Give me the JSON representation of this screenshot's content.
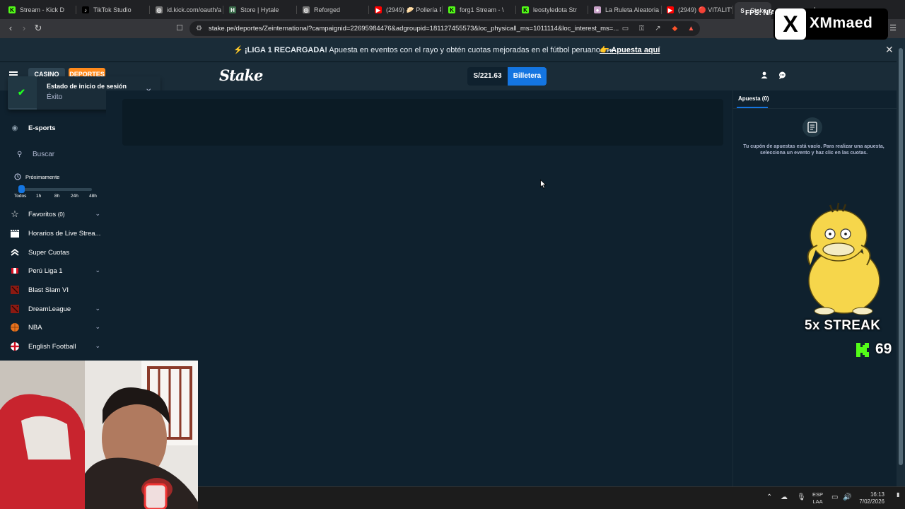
{
  "browser": {
    "tabs": [
      {
        "label": "Stream - Kick D",
        "fav": "K",
        "color": "#53fc18"
      },
      {
        "label": "TikTok Studio",
        "fav": "♪",
        "color": "#000000"
      },
      {
        "label": "id.kick.com/oauth/a",
        "fav": "◎",
        "color": "#777777"
      },
      {
        "label": "Store | Hytale",
        "fav": "H",
        "color": "#3a6b4a"
      },
      {
        "label": "Reforged",
        "fav": "◎",
        "color": "#777777"
      },
      {
        "label": "(2949) 🥟 Pollería P",
        "fav": "▶",
        "color": "#ff0000"
      },
      {
        "label": "forg1 Stream - \\",
        "fav": "K",
        "color": "#53fc18"
      },
      {
        "label": "leostyledota Str",
        "fav": "K",
        "color": "#53fc18"
      },
      {
        "label": "La Ruleta Aleatoria",
        "fav": "●",
        "color": "#c8a2c8"
      },
      {
        "label": "(2949) 🔴 VITALITY",
        "fav": "▶",
        "color": "#ff0000"
      },
      {
        "label": "Stake.pe",
        "fav": "S",
        "color": "#35363a"
      }
    ],
    "url": "stake.pe/deportes/Zeinternational?campaignid=22695984476&adgroupid=181127455573&loc_physicall_ms=1011114&loc_interest_ms=..."
  },
  "promo": {
    "headline": "¡LIGA 1 RECARGADA!",
    "body": " Apuesta en eventos con el rayo y obtén cuotas mejoradas en el fútbol peruano.",
    "flag": "PE",
    "cta": "Apuesta aquí"
  },
  "header": {
    "casino": "CASINO",
    "sports": "DEPORTES",
    "logo": "Stake",
    "balance": "S/221.63",
    "wallet": "Billetera"
  },
  "toast": {
    "title": "Estado de inicio de sesión",
    "message": "Éxito"
  },
  "sidebar": {
    "esports": "E-sports",
    "search": "Buscar",
    "soon": "Próximamente",
    "ticks": [
      "Todos",
      "1h",
      "8h",
      "24h",
      "48h"
    ],
    "items": [
      {
        "label": "Favoritos",
        "count": "(0)",
        "icon": "star-icon"
      },
      {
        "label": "Horarios de Live Strea...",
        "icon": "clapper-icon"
      },
      {
        "label": "Super Cuotas",
        "icon": "chevrons-up-icon"
      },
      {
        "label": "Perú Liga 1",
        "icon": "peru-flag-icon"
      },
      {
        "label": "Blast Slam VI",
        "icon": "dota-icon"
      },
      {
        "label": "DreamLeague",
        "icon": "dota-icon"
      },
      {
        "label": "NBA",
        "icon": "basketball-icon"
      },
      {
        "label": "English Football",
        "icon": "england-flag-icon"
      }
    ]
  },
  "betslip": {
    "tab": "Apuesta (0)",
    "empty": "Tu cupón de apuestas está vacío. Para realizar una apuesta, selecciona un evento y haz clic en las cuotas."
  },
  "overlay": {
    "fps": "FPS: N/A",
    "x_logo": "X",
    "x_name": "XMmaed",
    "streak": "5x STREAK",
    "k_count": "69"
  },
  "taskbar": {
    "lang_top": "ESP",
    "lang_bottom": "LAA",
    "time": "16:13",
    "date": "7/02/2026"
  }
}
